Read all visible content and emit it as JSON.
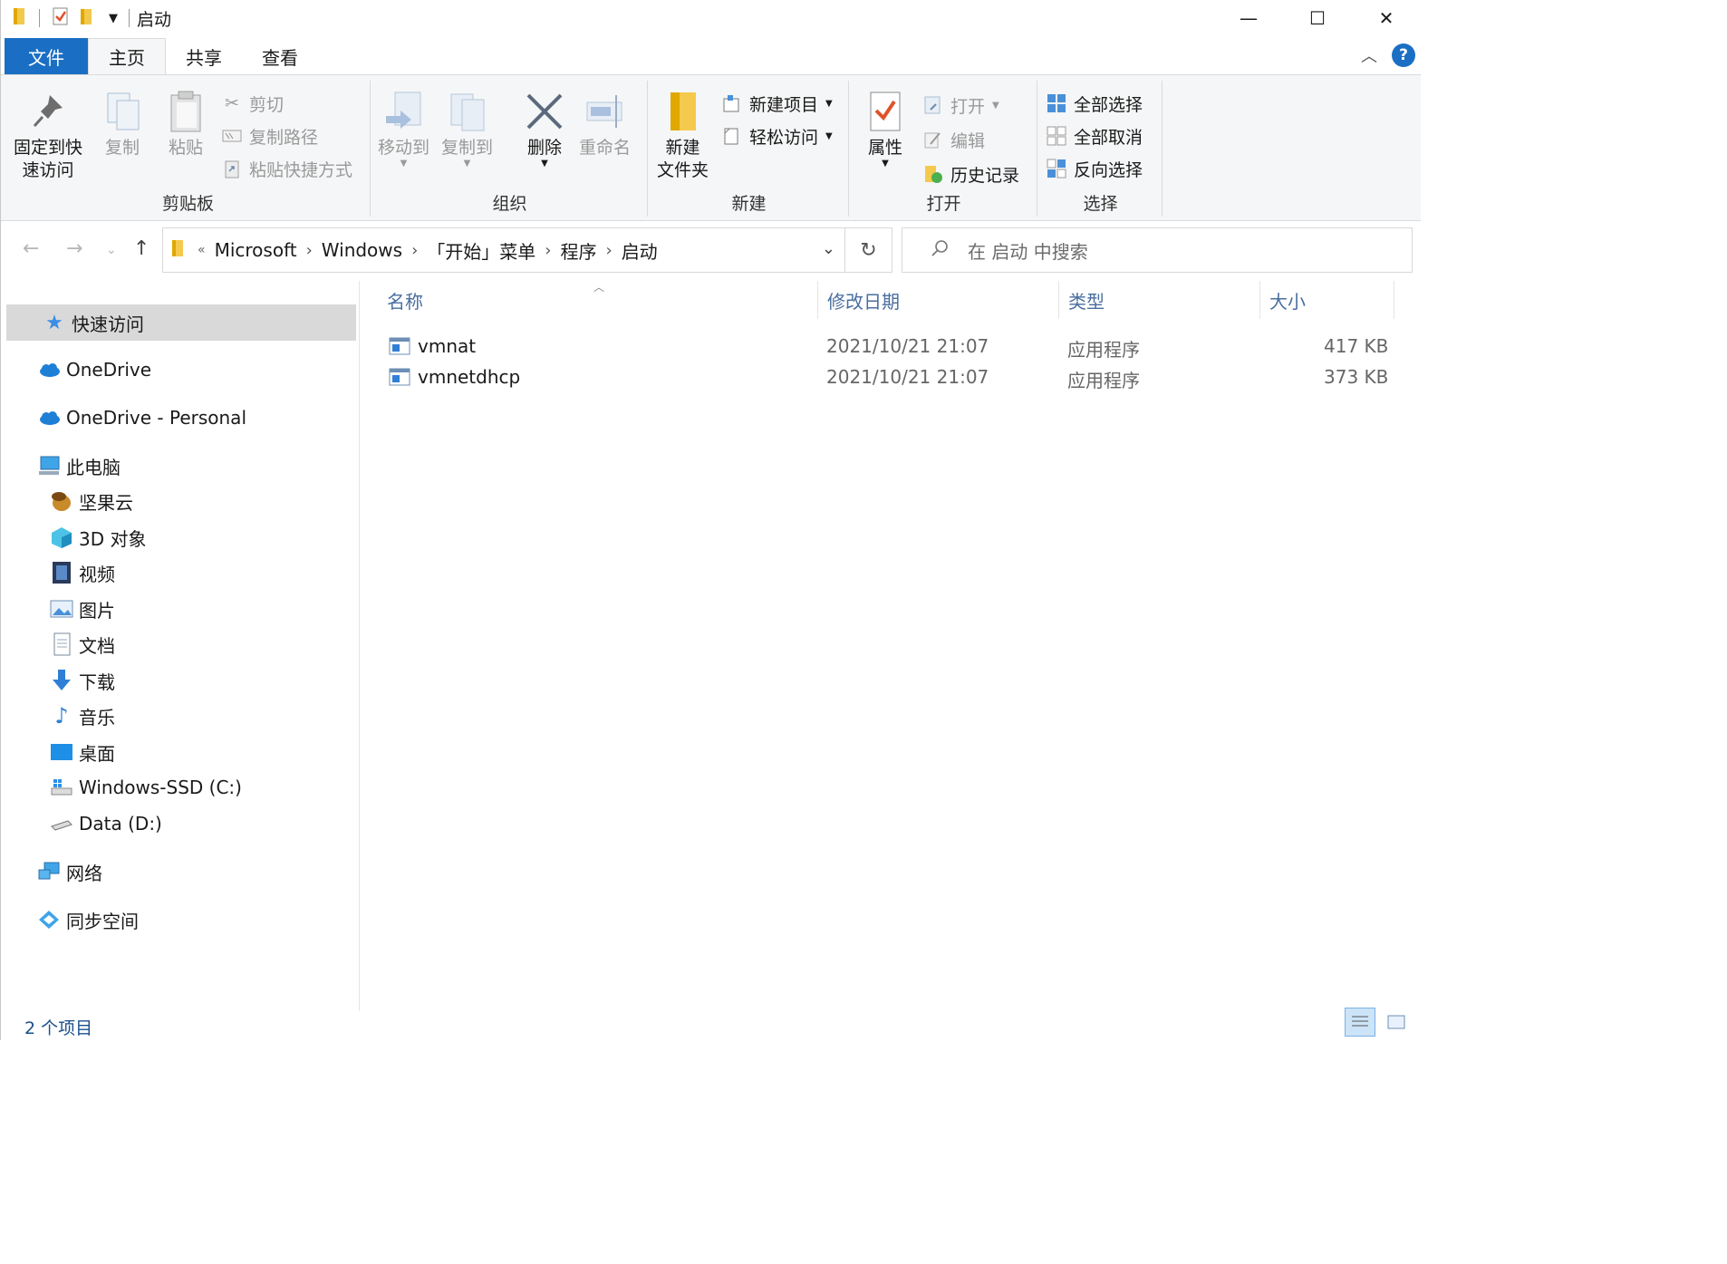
{
  "window": {
    "title": "启动",
    "minimize": "—",
    "maximize": "☐",
    "close": "✕"
  },
  "ribbon_tabs": [
    "文件",
    "主页",
    "共享",
    "查看"
  ],
  "ribbon": {
    "clipboard": {
      "label": "剪贴板",
      "pin_line1": "固定到快",
      "pin_line2": "速访问",
      "copy": "复制",
      "paste": "粘贴",
      "cut": "剪切",
      "copy_path": "复制路径",
      "paste_shortcut": "粘贴快捷方式"
    },
    "organize": {
      "label": "组织",
      "move_to": "移动到",
      "copy_to": "复制到",
      "delete": "删除",
      "rename": "重命名"
    },
    "new": {
      "label": "新建",
      "new_folder_line1": "新建",
      "new_folder_line2": "文件夹",
      "new_item": "新建项目",
      "easy_access": "轻松访问"
    },
    "open": {
      "label": "打开",
      "properties": "属性",
      "open": "打开",
      "edit": "编辑",
      "history": "历史记录"
    },
    "select": {
      "label": "选择",
      "select_all": "全部选择",
      "select_none": "全部取消",
      "invert": "反向选择"
    }
  },
  "address": {
    "overflow": "«",
    "crumbs": [
      "Microsoft",
      "Windows",
      "「开始」菜单",
      "程序",
      "启动"
    ]
  },
  "search": {
    "placeholder": "在 启动 中搜索"
  },
  "nav": {
    "quick_access": "快速访问",
    "onedrive": "OneDrive",
    "onedrive_personal": "OneDrive - Personal",
    "this_pc": "此电脑",
    "nutstore": "坚果云",
    "objects3d": "3D 对象",
    "videos": "视频",
    "pictures": "图片",
    "documents": "文档",
    "downloads": "下载",
    "music": "音乐",
    "desktop": "桌面",
    "drive_c": "Windows-SSD (C:)",
    "drive_d": "Data (D:)",
    "network": "网络",
    "sync_space": "同步空间"
  },
  "columns": {
    "name": "名称",
    "date": "修改日期",
    "type": "类型",
    "size": "大小"
  },
  "files": [
    {
      "name": "vmnat",
      "date": "2021/10/21 21:07",
      "type": "应用程序",
      "size": "417 KB"
    },
    {
      "name": "vmnetdhcp",
      "date": "2021/10/21 21:07",
      "type": "应用程序",
      "size": "373 KB"
    }
  ],
  "status": {
    "count": "2 个项目"
  }
}
